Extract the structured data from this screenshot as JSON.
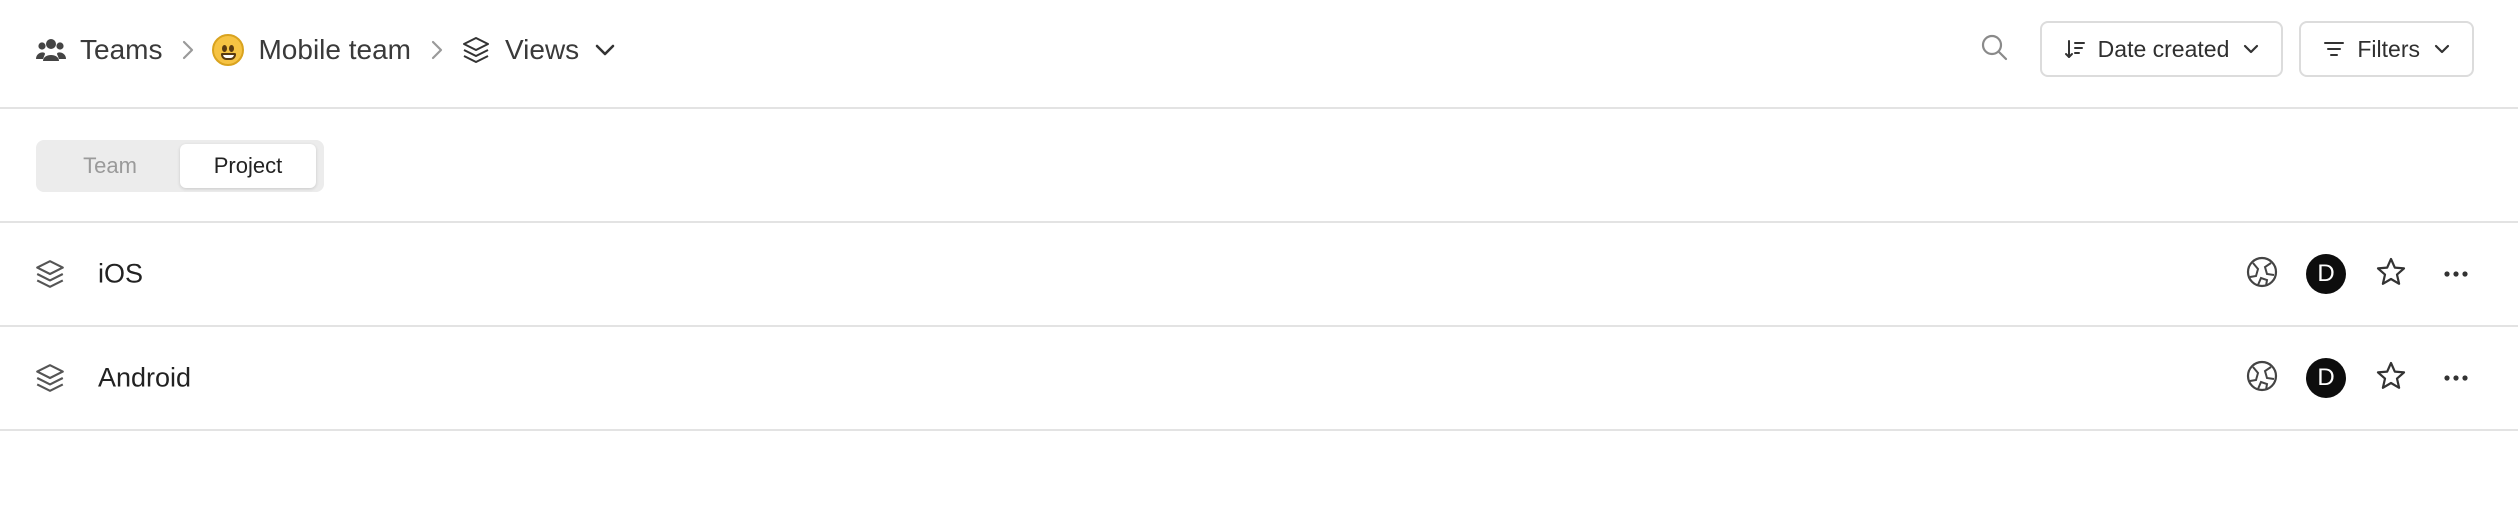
{
  "breadcrumb": {
    "teams": {
      "label": "Teams",
      "icon": "team-icon"
    },
    "team": {
      "label": "Mobile team",
      "icon": "grinning-face-emoji"
    },
    "views": {
      "label": "Views",
      "icon": "layers-icon"
    }
  },
  "header": {
    "sort": {
      "label": "Date created",
      "icon": "sort-descending-icon"
    },
    "filters": {
      "label": "Filters",
      "icon": "filter-icon"
    }
  },
  "segment": {
    "options": [
      "Team",
      "Project"
    ],
    "selected": "Project"
  },
  "views": [
    {
      "title": "iOS",
      "icon": "layers-icon",
      "avatar_initial": "D"
    },
    {
      "title": "Android",
      "icon": "layers-icon",
      "avatar_initial": "D"
    }
  ],
  "colors": {
    "border": "#e3e3e3",
    "avatar_bg": "#0d0d0d",
    "segment_bg": "#ececec",
    "muted_text": "#9a9a9a"
  }
}
